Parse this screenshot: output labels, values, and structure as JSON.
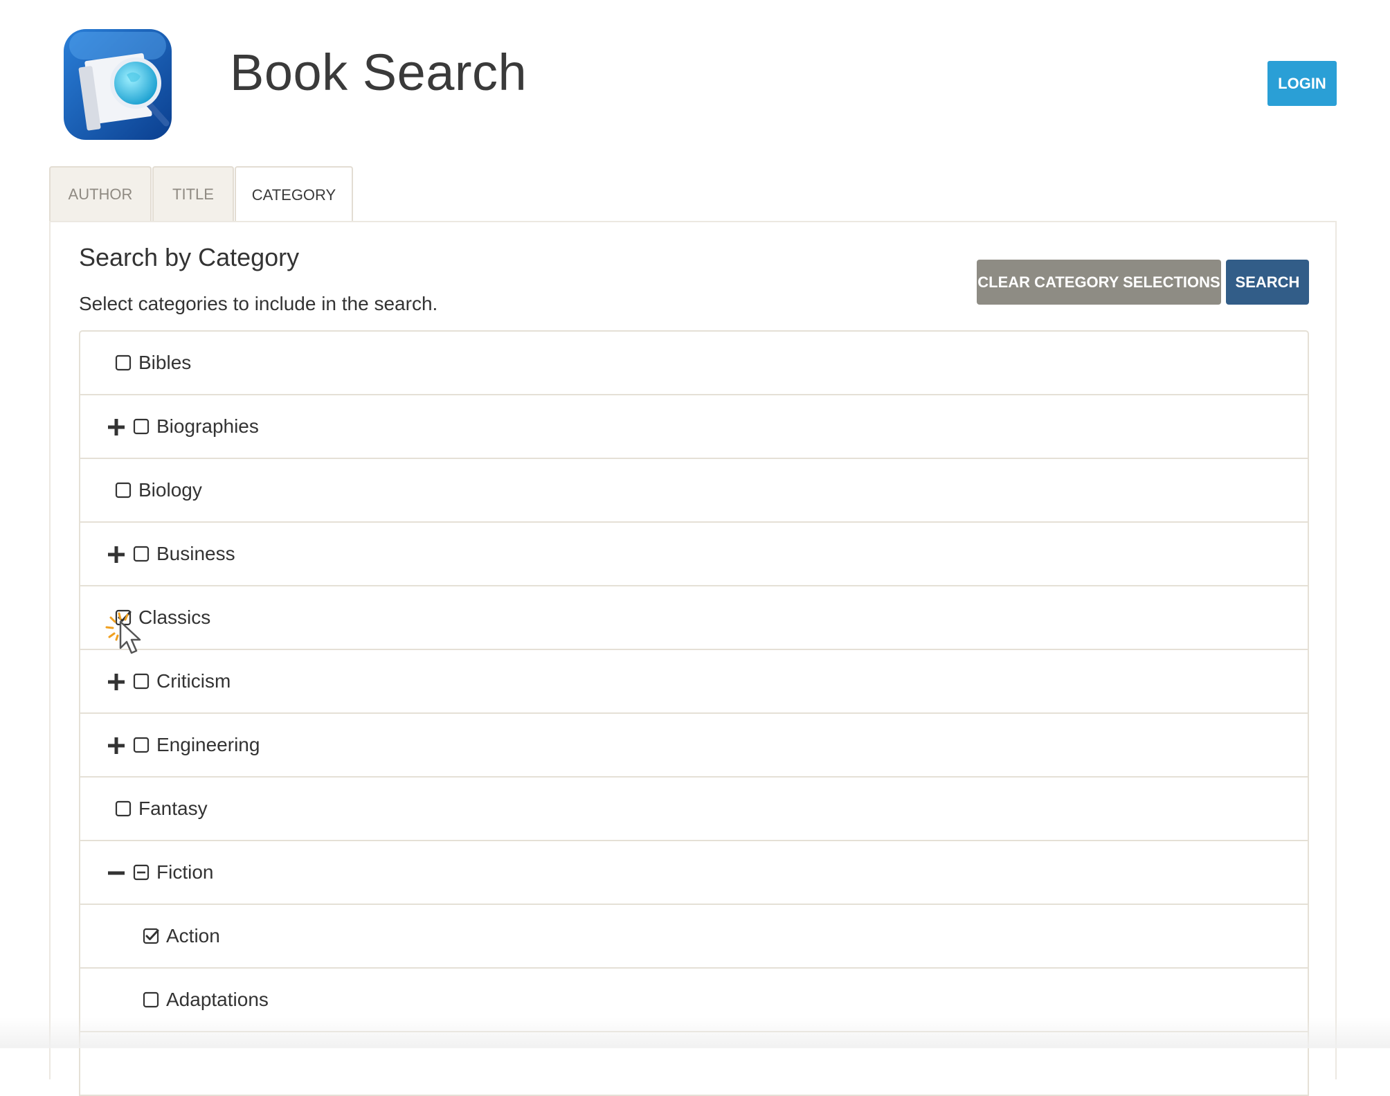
{
  "header": {
    "logo_icon": "book-search-globe-magnifier-icon",
    "title": "Book Search",
    "login_label": "LOGIN"
  },
  "tabs": [
    {
      "label": "AUTHOR",
      "active": false
    },
    {
      "label": "TITLE",
      "active": false
    },
    {
      "label": "CATEGORY",
      "active": true
    }
  ],
  "panel": {
    "title": "Search by Category",
    "description": "Select categories to include in the search.",
    "clear_label": "CLEAR CATEGORY SELECTIONS",
    "search_label": "SEARCH"
  },
  "categories": [
    {
      "label": "Bibles",
      "expander": "none",
      "state": "unchecked",
      "level": 0
    },
    {
      "label": "Biographies",
      "expander": "plus",
      "state": "unchecked",
      "level": 0
    },
    {
      "label": "Biology",
      "expander": "none",
      "state": "unchecked",
      "level": 0
    },
    {
      "label": "Business",
      "expander": "plus",
      "state": "unchecked",
      "level": 0
    },
    {
      "label": "Classics",
      "expander": "none",
      "state": "checked",
      "level": 0
    },
    {
      "label": "Criticism",
      "expander": "plus",
      "state": "unchecked",
      "level": 0
    },
    {
      "label": "Engineering",
      "expander": "plus",
      "state": "unchecked",
      "level": 0
    },
    {
      "label": "Fantasy",
      "expander": "none",
      "state": "unchecked",
      "level": 0
    },
    {
      "label": "Fiction",
      "expander": "minus",
      "state": "partial",
      "level": 0
    },
    {
      "label": "Action",
      "expander": "none",
      "state": "checked",
      "level": 1
    },
    {
      "label": "Adaptations",
      "expander": "none",
      "state": "unchecked",
      "level": 1
    },
    {
      "label": "",
      "expander": "none",
      "state": "none",
      "level": 1
    }
  ],
  "colors": {
    "login_button": "#2a9fd6",
    "search_button": "#325d88",
    "clear_button": "#8e8c84",
    "border": "#e5e0d6"
  }
}
